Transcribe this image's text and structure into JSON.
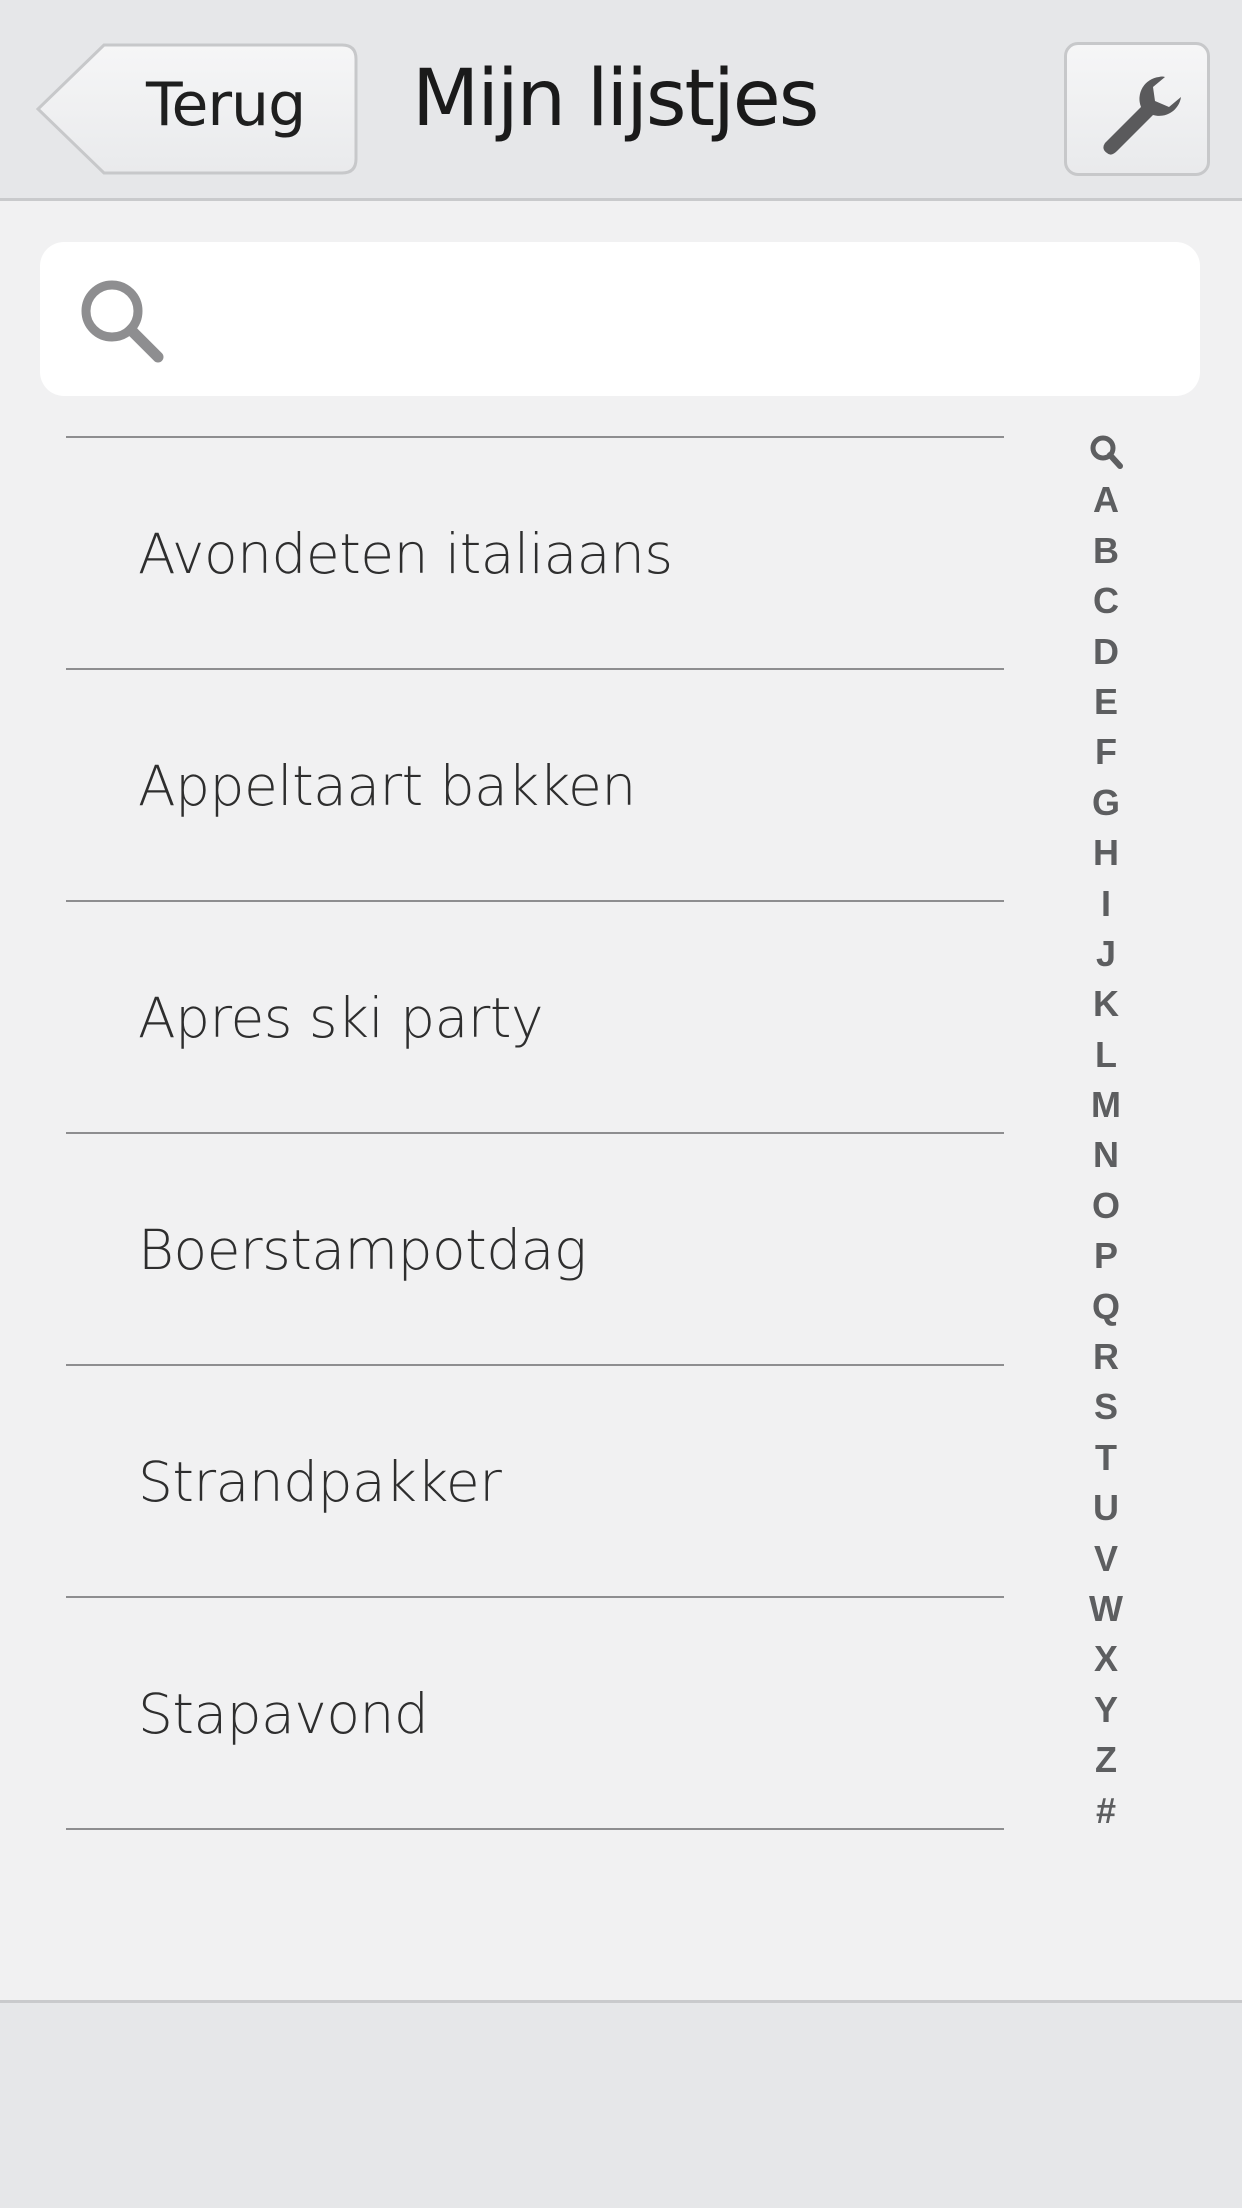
{
  "header": {
    "back_label": "Terug",
    "title": "Mijn lijstjes",
    "settings_icon": "wrench-icon"
  },
  "search": {
    "placeholder": "",
    "value": "",
    "icon": "search-icon"
  },
  "lists": [
    {
      "label": "Avondeten italiaans"
    },
    {
      "label": "Appeltaart bakken"
    },
    {
      "label": "Apres ski party"
    },
    {
      "label": "Boerstampotdag"
    },
    {
      "label": "Strandpakker"
    },
    {
      "label": "Stapavond"
    }
  ],
  "index": [
    "A",
    "B",
    "C",
    "D",
    "E",
    "F",
    "G",
    "H",
    "I",
    "J",
    "K",
    "L",
    "M",
    "N",
    "O",
    "P",
    "Q",
    "R",
    "S",
    "T",
    "U",
    "V",
    "W",
    "X",
    "Y",
    "Z",
    "#"
  ],
  "colors": {
    "bar_background": "#e6e7e9",
    "content_background": "#f1f1f2",
    "index_text": "#5d5e60"
  }
}
